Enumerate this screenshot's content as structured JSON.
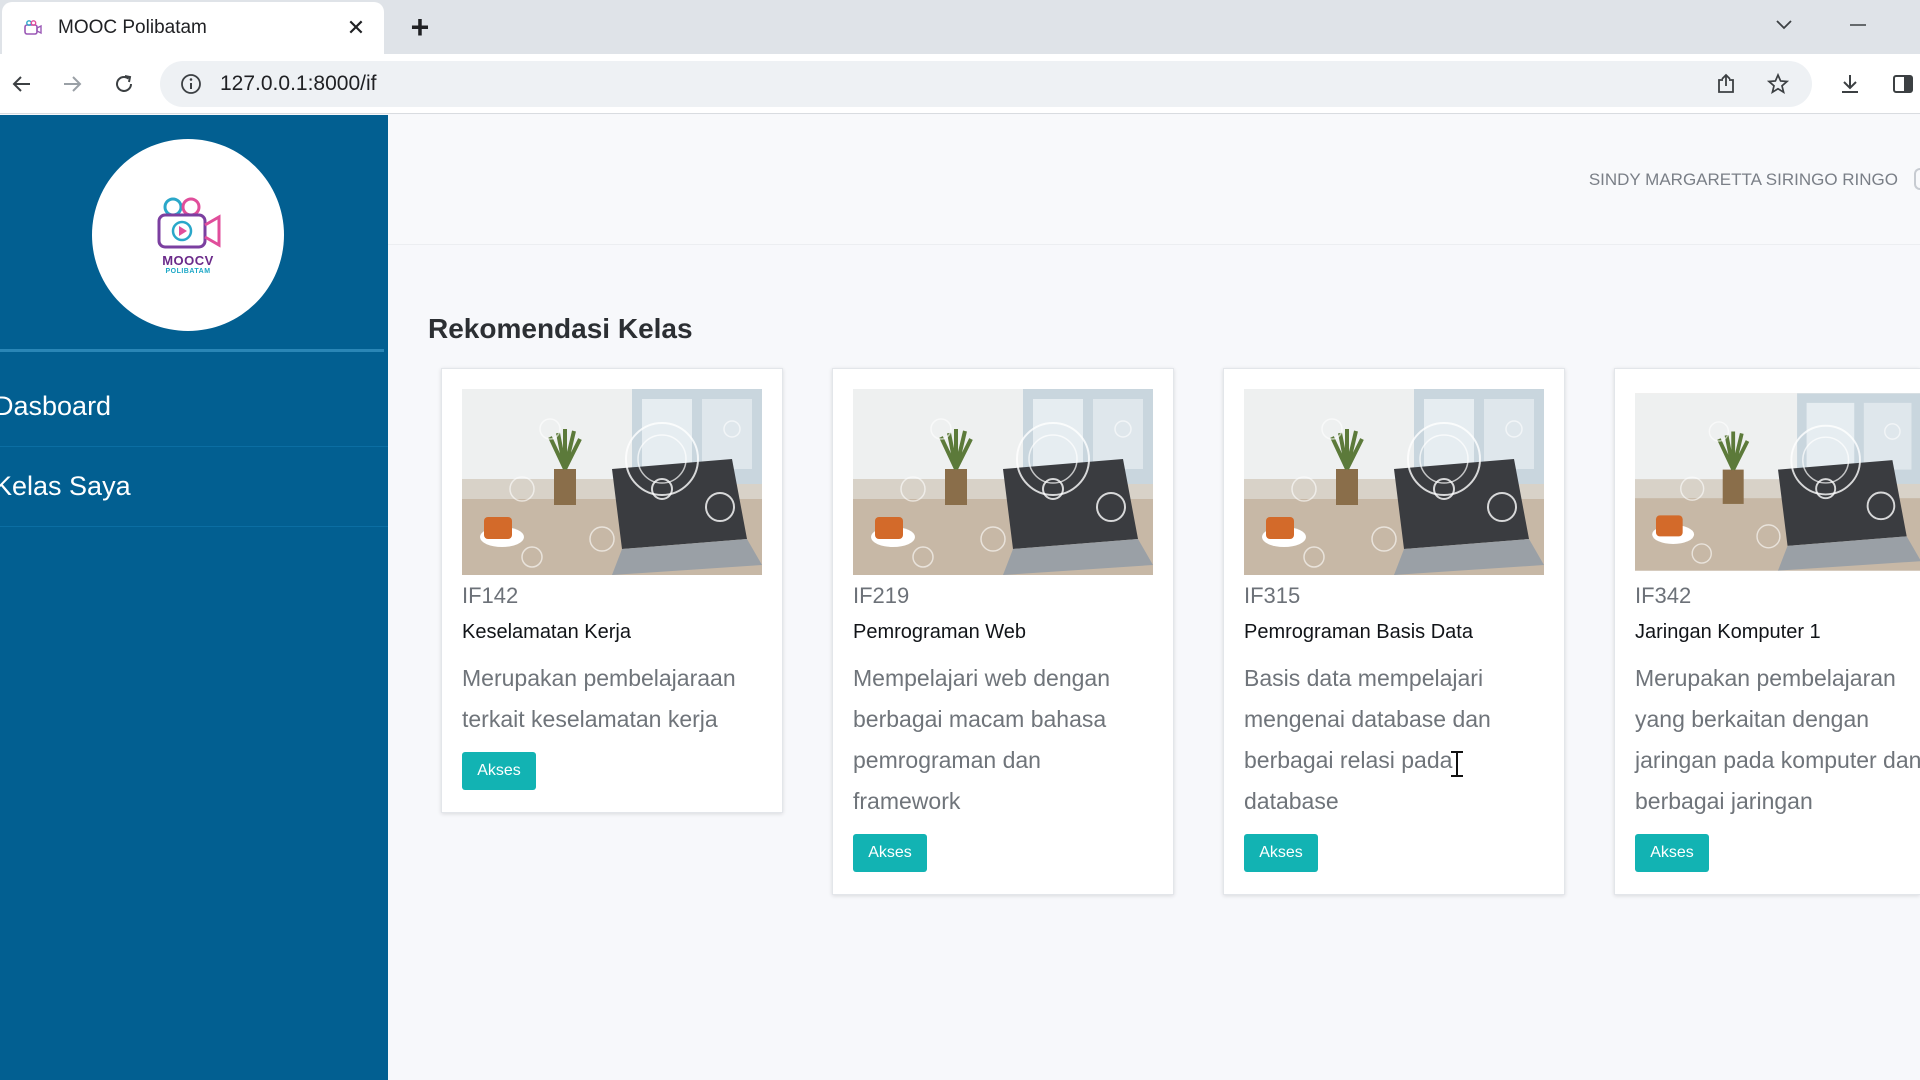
{
  "browser": {
    "tab_title": "MOOC Polibatam",
    "close_glyph": "✕",
    "newtab_glyph": "+",
    "url": "127.0.0.1:8000/if"
  },
  "logo": {
    "text": "MOOCV",
    "subtext": "POLIBATAM"
  },
  "sidebar": {
    "items": [
      {
        "label": "Dasboard"
      },
      {
        "label": "Kelas Saya"
      }
    ]
  },
  "header": {
    "user_name": "SINDY MARGARETTA SIRINGO RINGO"
  },
  "main": {
    "section_title": "Rekomendasi Kelas",
    "cards": [
      {
        "code": "IF142",
        "name": "Keselamatan Kerja",
        "description": "Merupakan pembelajaraan terkait keselamatan kerja",
        "button": "Akses"
      },
      {
        "code": "IF219",
        "name": "Pemrograman Web",
        "description": "Mempelajari web dengan berbagai macam bahasa pemrograman dan framework",
        "button": "Akses"
      },
      {
        "code": "IF315",
        "name": "Pemrograman Basis Data",
        "description": "Basis data mempelajari mengenai database dan berbagai relasi pada database",
        "button": "Akses"
      },
      {
        "code": "IF342",
        "name": "Jaringan Komputer 1",
        "description": "Merupakan pembelajaran yang berkaitan dengan jaringan pada komputer dan berbagai jaringan",
        "button": "Akses"
      }
    ]
  },
  "colors": {
    "sidebar_bg": "#025f91",
    "button_bg": "#12b3b3",
    "page_bg": "#f7f8fb"
  },
  "icons": [
    "favicon-icon",
    "close-icon",
    "plus-icon",
    "chevron-down-icon",
    "minimize-icon",
    "back-icon",
    "forward-icon",
    "reload-icon",
    "info-icon",
    "share-icon",
    "star-icon",
    "download-icon",
    "sidepanel-icon",
    "camera-logo-icon",
    "text-cursor-icon"
  ]
}
